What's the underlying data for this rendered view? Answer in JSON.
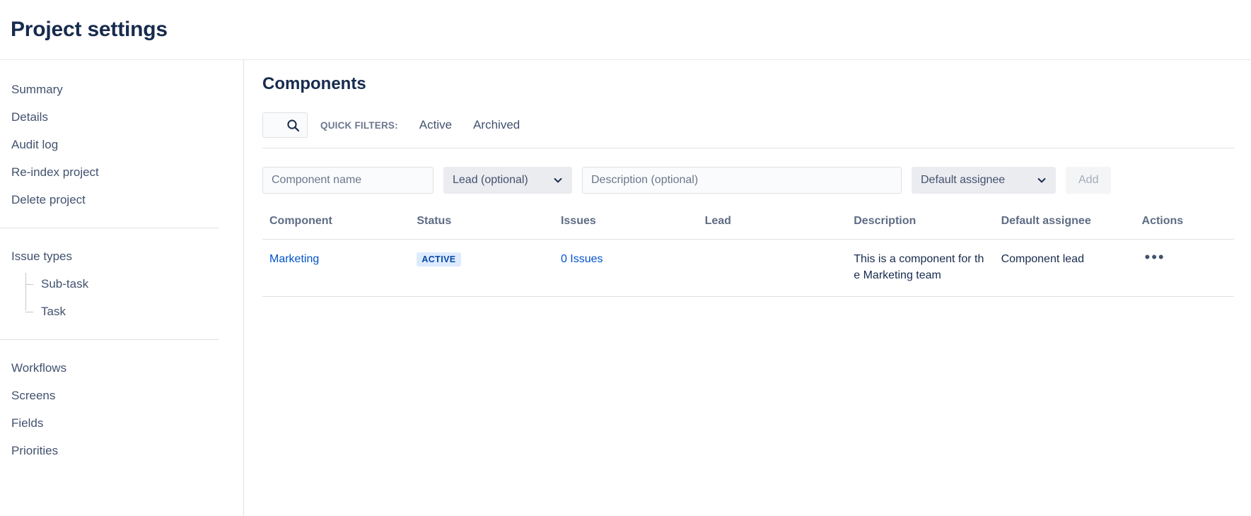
{
  "header": {
    "title": "Project settings"
  },
  "sidebar": {
    "group1": [
      {
        "label": "Summary",
        "name": "summary"
      },
      {
        "label": "Details",
        "name": "details"
      },
      {
        "label": "Audit log",
        "name": "audit-log"
      },
      {
        "label": "Re-index project",
        "name": "re-index-project"
      },
      {
        "label": "Delete project",
        "name": "delete-project"
      }
    ],
    "issue_types": {
      "label": "Issue types",
      "children": [
        {
          "label": "Sub-task",
          "name": "sub-task"
        },
        {
          "label": "Task",
          "name": "task"
        }
      ]
    },
    "group3": [
      {
        "label": "Workflows",
        "name": "workflows"
      },
      {
        "label": "Screens",
        "name": "screens"
      },
      {
        "label": "Fields",
        "name": "fields"
      },
      {
        "label": "Priorities",
        "name": "priorities"
      }
    ]
  },
  "main": {
    "title": "Components",
    "filters": {
      "search_icon": "search-icon",
      "quick_filters_label": "QUICK FILTERS:",
      "options": [
        {
          "label": "Active",
          "name": "active"
        },
        {
          "label": "Archived",
          "name": "archived"
        }
      ]
    },
    "add_form": {
      "name_placeholder": "Component name",
      "name_value": "",
      "lead_selected": "Lead (optional)",
      "description_placeholder": "Description (optional)",
      "description_value": "",
      "assignee_selected": "Default assignee",
      "add_label": "Add"
    },
    "table": {
      "columns": [
        "Component",
        "Status",
        "Issues",
        "Lead",
        "Description",
        "Default assignee",
        "Actions"
      ],
      "rows": [
        {
          "component": "Marketing",
          "status": "ACTIVE",
          "issues": "0 Issues",
          "lead": "",
          "description": "This is a component for the Marketing team",
          "default_assignee": "Component lead",
          "actions": "•••"
        }
      ]
    }
  },
  "colors": {
    "link": "#0052cc",
    "heading": "#172b4d",
    "muted": "#6b778c",
    "border": "#dfe1e6",
    "lozenge_bg": "#deebff",
    "lozenge_text": "#0747a6"
  }
}
